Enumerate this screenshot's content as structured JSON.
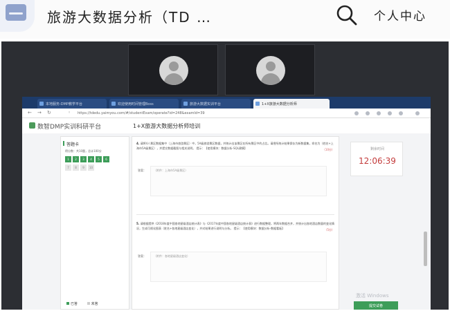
{
  "app": {
    "title": "旅游大数据分析（TD …",
    "personal_center": "个人中心"
  },
  "browser": {
    "tabs": [
      {
        "label": "本地服务-DMP教学平台"
      },
      {
        "label": "欢迎使用时间管理Boss"
      },
      {
        "label": "旅游大数据实训平台"
      },
      {
        "label": "1+X旅游大数据分析师"
      }
    ],
    "url": "https://tdedu.yaimyou.com/#/studentExam/operate?id=248&examId=39"
  },
  "site": {
    "brand": "数智DMP实训科研平台",
    "exam_title": "1+X旅游大数据分析师培训"
  },
  "answer_card": {
    "title": "答题卡",
    "summary": "得分数：共10题，总计100分",
    "questions": [
      "1",
      "2",
      "3",
      "4",
      "5",
      "6",
      "7",
      "8",
      "9",
      "10"
    ],
    "answered": [
      true,
      true,
      true,
      true,
      true,
      true,
      false,
      false,
      false,
      false
    ],
    "legend_answered": "已答",
    "legend_unanswered": "未答"
  },
  "questions": [
    {
      "number": "4.",
      "text": "请将4人景区数据集中（上海市旅游景区）中，5A级旅游景区数据，并统计出该景区在所有景区中的占比。请把所统计结果保存为新数据集，命名为（姓名+上海市5A级景区），并提交数据截图与相关说明。",
      "hint": "提示：【使用模块：数据分析-SQL建模】",
      "score": "（10分）",
      "answer_label": "答案：",
      "answer_placeholder": "（附件：上海市5A级景区）"
    },
    {
      "number": "5.",
      "text": "请根据提供《2018年度中国各地星级酒店统计表》与《2017年度中国各地星级酒店统计表》进行数据整理，将两年数据合并，并统计出各地酒店数量的变化情况，生成可视化图表（姓名+各地星级酒店变化），并对结果进行说明与分析。",
      "hint": "提示：【使用模块：数据分析-数据看板】",
      "score": "（5分）",
      "answer_label": "答案：",
      "answer_placeholder": "（附件：各地星级酒店变化）"
    }
  ],
  "timer": {
    "label": "剩余时间",
    "value": "12:06:39"
  },
  "watermark": "激活 Windows",
  "submit_label": "提交试卷",
  "colors": {
    "accent_green": "#3d9d59",
    "timer_red": "#c33b3b",
    "tabbar_blue": "#1d3b6a"
  }
}
